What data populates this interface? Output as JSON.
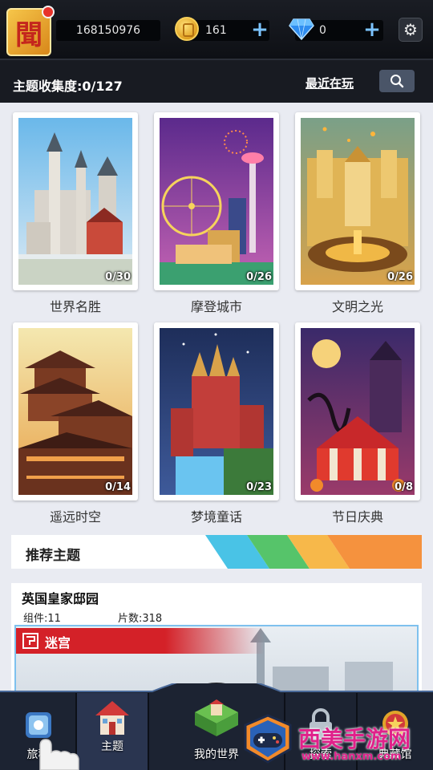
{
  "header": {
    "avatar_char": "聞",
    "user_id": "168150976",
    "coins": "161",
    "gems": "0",
    "plus": "+"
  },
  "collection": {
    "title": "主题收集度:0/127",
    "recent_link": "最近在玩"
  },
  "themes": [
    {
      "label": "世界名胜",
      "count": "0/30"
    },
    {
      "label": "摩登城市",
      "count": "0/26"
    },
    {
      "label": "文明之光",
      "count": "0/26"
    },
    {
      "label": "遥远时空",
      "count": "0/14"
    },
    {
      "label": "梦境童话",
      "count": "0/23"
    },
    {
      "label": "节日庆典",
      "count": "0/8"
    }
  ],
  "recommended": {
    "title": "推荐主题",
    "stripe_colors": [
      "#49c3e6",
      "#56c46a",
      "#f7b84a",
      "#f5923e"
    ],
    "item": {
      "name": "英国皇家邸园",
      "components": "组件:11",
      "pieces": "片数:318",
      "tag": "迷宫"
    }
  },
  "nav": {
    "items": [
      {
        "label": "旅程"
      },
      {
        "label": "主题"
      },
      {
        "label": "我的世界"
      },
      {
        "label": "探索"
      },
      {
        "label": "典藏馆"
      }
    ]
  },
  "watermark": {
    "title": "西美手游网",
    "url": "www.hanxm.com"
  }
}
